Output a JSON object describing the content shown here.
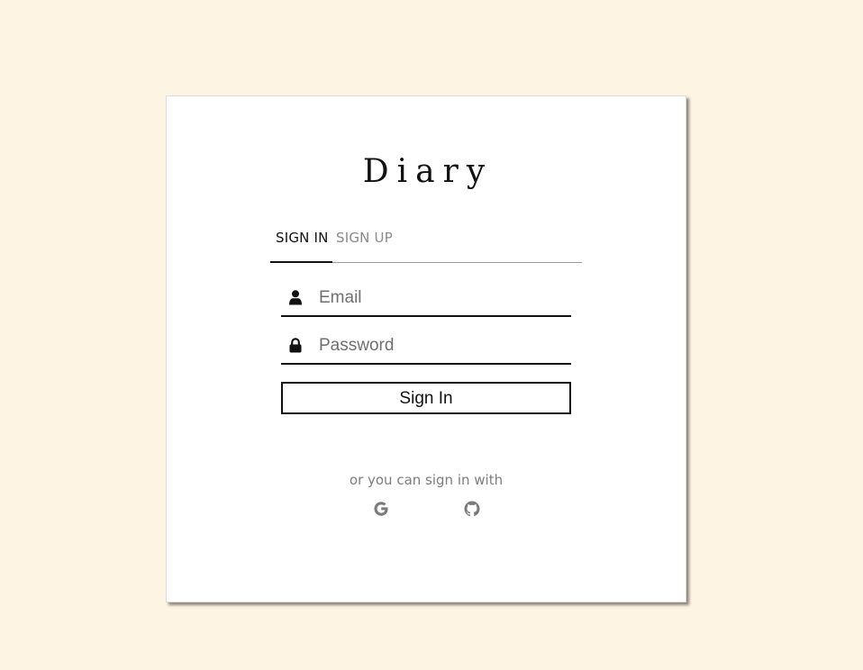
{
  "app": {
    "title": "Diary"
  },
  "tabs": [
    {
      "label": "SIGN IN",
      "active": true
    },
    {
      "label": "SIGN UP",
      "active": false
    }
  ],
  "form": {
    "email_placeholder": "Email",
    "email_value": "",
    "password_placeholder": "Password",
    "password_value": "",
    "submit_label": "Sign In"
  },
  "alt_signin": {
    "text": "or you can sign in with",
    "providers": [
      {
        "name": "Google",
        "icon": "google-icon"
      },
      {
        "name": "GitHub",
        "icon": "github-icon"
      }
    ]
  },
  "colors": {
    "background": "#fdf4e4",
    "card": "#ffffff",
    "text": "#111111",
    "muted": "#8a8a8a"
  }
}
